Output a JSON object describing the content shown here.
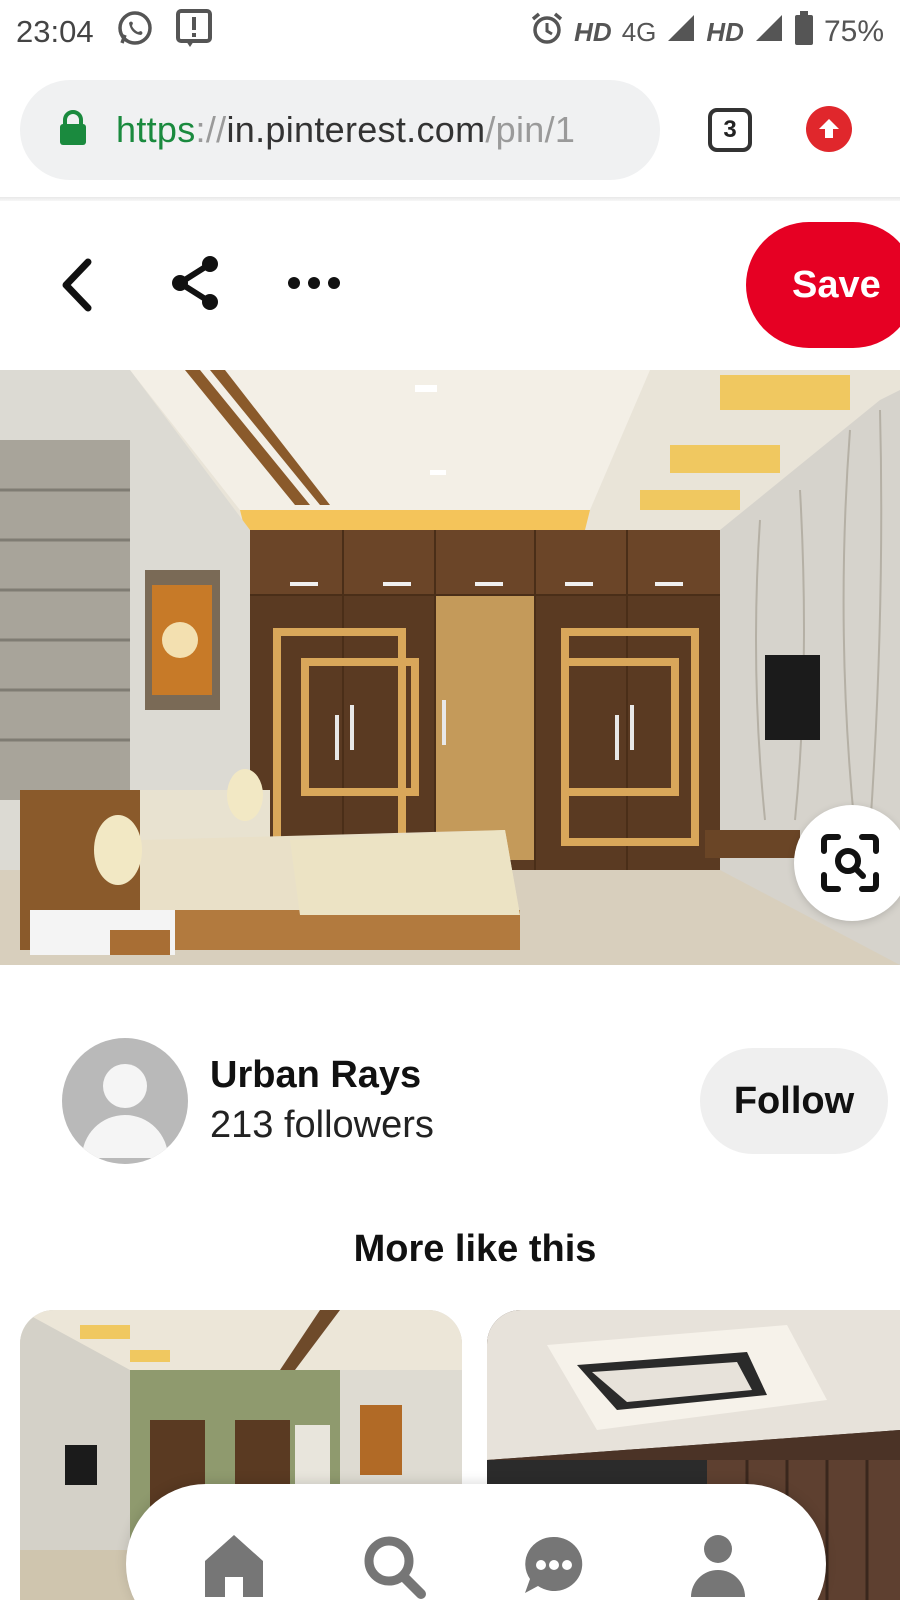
{
  "status_bar": {
    "time": "23:04",
    "network_1": "HD",
    "network_type": "4G",
    "network_2": "HD",
    "battery_percent": "75%",
    "icons": [
      "whatsapp-icon",
      "alert-notification-icon",
      "alarm-icon",
      "signal-icon",
      "battery-icon"
    ]
  },
  "browser": {
    "url_scheme": "https",
    "url_separator": "://",
    "url_host": "in.pinterest.com",
    "url_path": "/pin/1",
    "tab_count": "3",
    "icons": [
      "lock-icon",
      "upload-icon"
    ]
  },
  "pin": {
    "save_label": "Save",
    "icons": [
      "back-icon",
      "share-icon",
      "more-icon",
      "visual-search-icon"
    ]
  },
  "creator": {
    "name": "Urban Rays",
    "followers": "213 followers",
    "follow_label": "Follow"
  },
  "more_like_this": {
    "title": "More like this"
  },
  "bottom_nav": {
    "items": [
      "home-icon",
      "search-icon",
      "messages-icon",
      "profile-icon"
    ]
  },
  "colors": {
    "save_red": "#e60023",
    "secure_green": "#1a8a3e",
    "follow_bg": "#efefef"
  }
}
